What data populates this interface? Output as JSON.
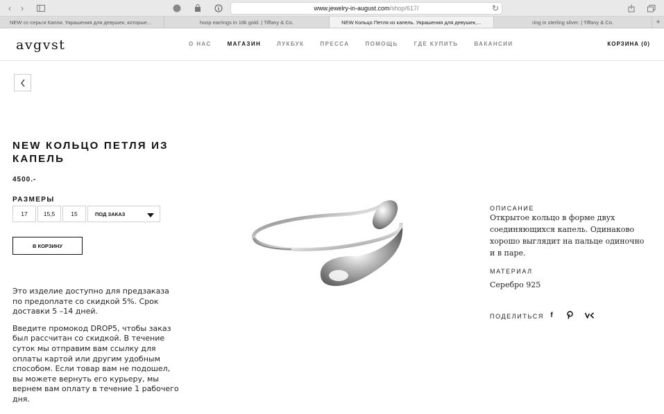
{
  "browser": {
    "url_host": "www.jewelry-in-august.com",
    "url_path": "/shop/617/",
    "tabs": [
      {
        "title": "NEW сс-серьги Капли. Украшения для девушек, которые..."
      },
      {
        "title": "hoop earrings in 18k gold. | Tiffany & Co."
      },
      {
        "title": "NEW Кольцо Петля из капель. Украшения для девушек,..."
      },
      {
        "title": "ring in sterling silver. | Tiffany & Co."
      }
    ],
    "active_tab": 2,
    "new_tab_label": "+"
  },
  "header": {
    "logo": "avgvst",
    "nav": [
      {
        "label": "О НАС"
      },
      {
        "label": "МАГАЗИН"
      },
      {
        "label": "ЛУКБУК"
      },
      {
        "label": "ПРЕССА"
      },
      {
        "label": "ПОМОЩЬ"
      },
      {
        "label": "ГДЕ КУПИТЬ"
      },
      {
        "label": "ВАКАНСИИ"
      }
    ],
    "active_nav": 1,
    "cart_label": "КОРЗИНА (0)"
  },
  "product": {
    "title": "NEW КОЛЬЦО ПЕТЛЯ ИЗ КАПЕЛЬ",
    "price": "4500.-",
    "sizes_label": "РАЗМЕРЫ",
    "sizes": [
      "17",
      "15,5",
      "15"
    ],
    "size_select_value": "ПОД ЗАКАЗ",
    "add_to_cart_label": "В КОРЗИНУ",
    "note_paragraph_1": "Это изделие доступно для предзаказа по предоплате со скидкой 5%. Срок доставки 5 –14 дней.",
    "note_paragraph_2": "Введите промокод DROP5, чтобы заказ был рассчитан со скидкой. В течение суток мы отправим вам ссылку для оплаты картой или другим удобным способом. Если товар вам не подошел, вы можете вернуть его курьеру, мы вернем вам оплату в течение 1 рабочего дня."
  },
  "details": {
    "description_label": "ОПИСАНИЕ",
    "description": "Открытое кольцо в форме двух соединяющихся капель. Одинаково хорошо выглядит на пальце одиночно и в паре.",
    "material_label": "МАТЕРИАЛ",
    "material": "Серебро 925",
    "share_label": "ПОДЕЛИТЬСЯ",
    "share_icons": [
      "facebook-icon",
      "pinterest-icon",
      "vk-icon"
    ]
  }
}
